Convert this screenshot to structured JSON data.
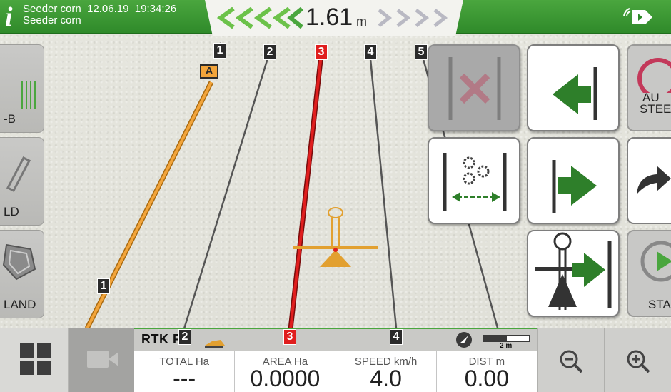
{
  "header": {
    "job_name": "Seeder corn_12.06.19_19:34:26",
    "implement_name": "Seeder corn",
    "info_icon": "info-icon",
    "satellite_icon": "satellite-signal-icon",
    "offset_value": "1.61",
    "offset_unit": "m"
  },
  "map": {
    "guidance_lines": [
      "1",
      "2",
      "3",
      "4",
      "5"
    ],
    "active_line": "3",
    "point_a_label": "A",
    "near_line_label": "1",
    "bottom_line_labels": [
      "2",
      "3",
      "4"
    ]
  },
  "left_panel": {
    "ab_label": "-B",
    "field_label": "LD",
    "land_label": "LAND"
  },
  "right_panel": {
    "auto_steer_label_1": "AU",
    "auto_steer_label_2": "STEE",
    "start_label": "STA"
  },
  "bottom": {
    "rtk_status": "RTK FX",
    "scale_label": "2 m",
    "stats": [
      {
        "caption": "TOTAL Ha",
        "value": "---"
      },
      {
        "caption": "AREA Ha",
        "value": "0.0000"
      },
      {
        "caption": "SPEED km/h",
        "value": "4.0"
      },
      {
        "caption": "DIST m",
        "value": "0.00"
      }
    ]
  },
  "colors": {
    "brand_green": "#3a9a33",
    "guidance_active": "#e01e1e",
    "guidance_ab": "#f0a030",
    "guidance_line": "#555555"
  }
}
